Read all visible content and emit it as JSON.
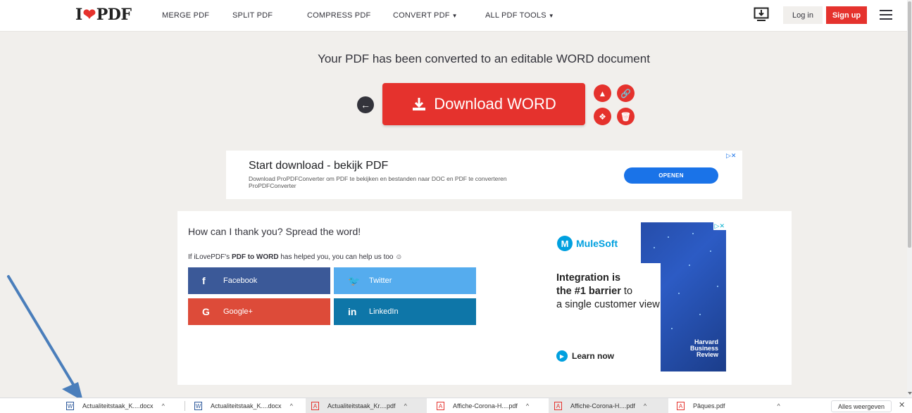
{
  "header": {
    "logo": {
      "left": "I",
      "right": "PDF"
    },
    "nav": [
      {
        "label": "MERGE PDF",
        "dropdown": false
      },
      {
        "label": "SPLIT PDF",
        "dropdown": false
      },
      {
        "label": "COMPRESS PDF",
        "dropdown": false
      },
      {
        "label": "CONVERT PDF",
        "dropdown": true
      },
      {
        "label": "ALL PDF TOOLS",
        "dropdown": true
      }
    ],
    "login": "Log in",
    "signup": "Sign up"
  },
  "main": {
    "headline": "Your PDF has been converted to an editable WORD document",
    "download_label": "Download WORD"
  },
  "ad1": {
    "title": "Start download - bekijk PDF",
    "desc": "Download ProPDFConverter om PDF te bekijken en bestanden naar DOC en PDF te converteren",
    "advertiser": "ProPDFConverter",
    "cta": "OPENEN"
  },
  "share": {
    "title": "How can I thank you? Spread the word!",
    "text_prefix": "If iLovePDF's ",
    "text_bold": "PDF to WORD",
    "text_suffix": " has helped you, you can help us too ☺",
    "buttons": {
      "facebook": "Facebook",
      "twitter": "Twitter",
      "google": "Google+",
      "linkedin": "LinkedIn"
    }
  },
  "ad2": {
    "brand": "MuleSoft",
    "headline_bold1": "Integration is",
    "headline_bold2": "the #1 barrier",
    "headline_rest1": " to",
    "headline_rest2": "a single customer view",
    "cta": "Learn now",
    "partner": "Harvard Business Review"
  },
  "downloads": {
    "items": [
      {
        "name": "Actualiteitstaak_K....docx",
        "type": "word"
      },
      {
        "name": "Actualiteitstaak_K....docx",
        "type": "word"
      },
      {
        "name": "Actualiteitstaak_Kr....pdf",
        "type": "pdf"
      },
      {
        "name": "Affiche-Corona-H....pdf",
        "type": "pdf"
      },
      {
        "name": "Affiche-Corona-H....pdf",
        "type": "pdf"
      },
      {
        "name": "Pâques.pdf",
        "type": "pdf"
      }
    ],
    "show_all": "Alles weergeven"
  },
  "colors": {
    "brand_red": "#e5322d",
    "background": "#f1efec",
    "facebook": "#3b5998",
    "twitter": "#55acee",
    "google": "#dd4b39",
    "linkedin": "#0e76a8",
    "annotation_arrow": "#4a7ebb"
  }
}
